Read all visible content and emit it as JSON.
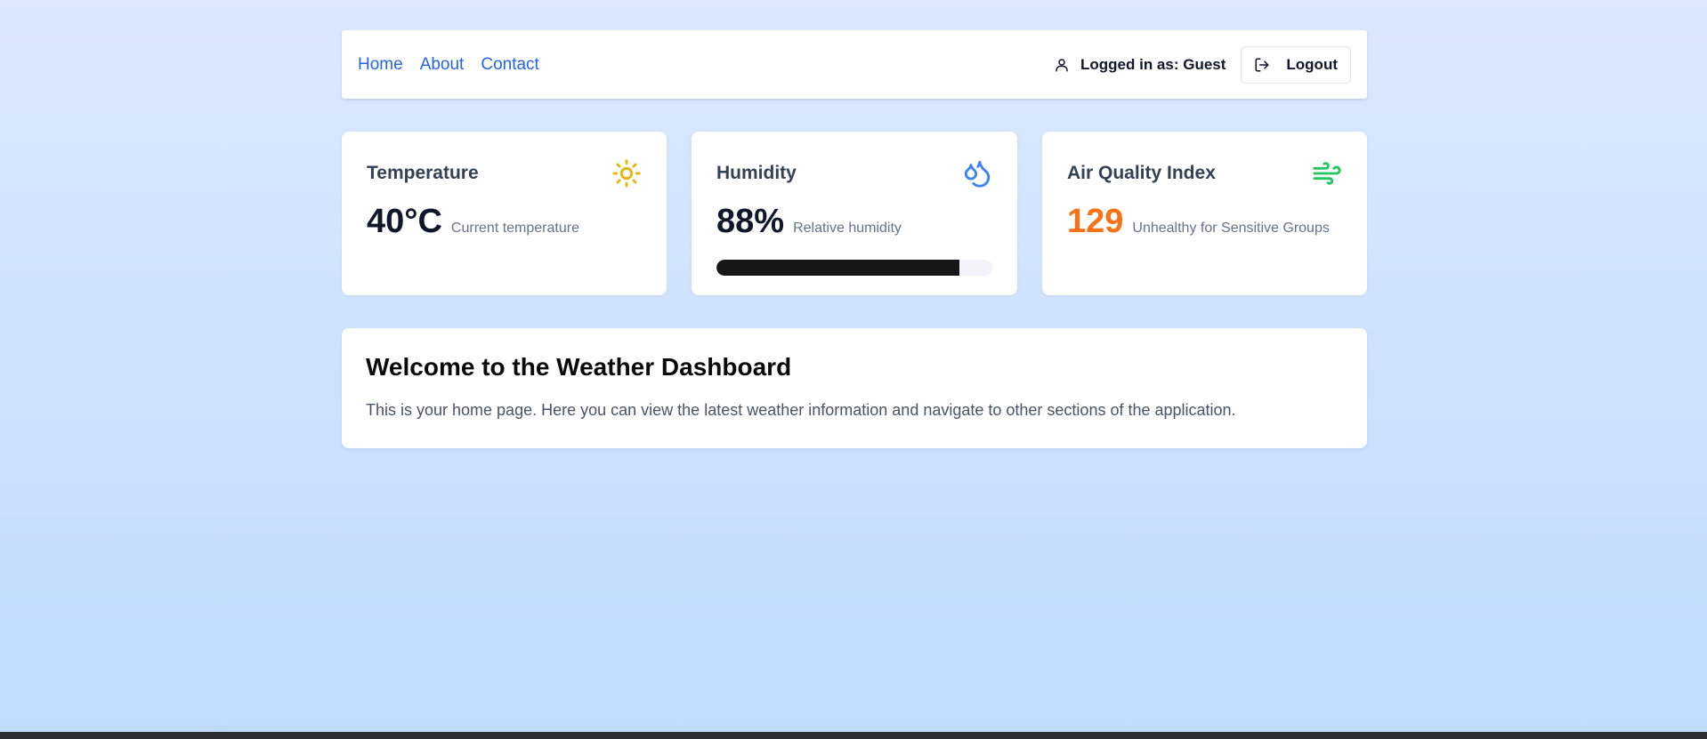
{
  "nav": {
    "links": [
      "Home",
      "About",
      "Contact"
    ],
    "user_status": "Logged in as: Guest",
    "logout_label": "Logout"
  },
  "cards": {
    "temperature": {
      "title": "Temperature",
      "value": "40°C",
      "label": "Current temperature",
      "icon": "sun-icon",
      "icon_color": "#eab308"
    },
    "humidity": {
      "title": "Humidity",
      "value": "88%",
      "label": "Relative humidity",
      "icon": "droplets-icon",
      "icon_color": "#3b82f6",
      "progress_percent": 88
    },
    "aqi": {
      "title": "Air Quality Index",
      "value": "129",
      "label": "Unhealthy for Sensitive Groups",
      "icon": "wind-icon",
      "icon_color": "#22c55e",
      "value_color": "#f97316"
    }
  },
  "welcome": {
    "title": "Welcome to the Weather Dashboard",
    "text": "This is your home page. Here you can view the latest weather information and navigate to other sections of the application."
  }
}
